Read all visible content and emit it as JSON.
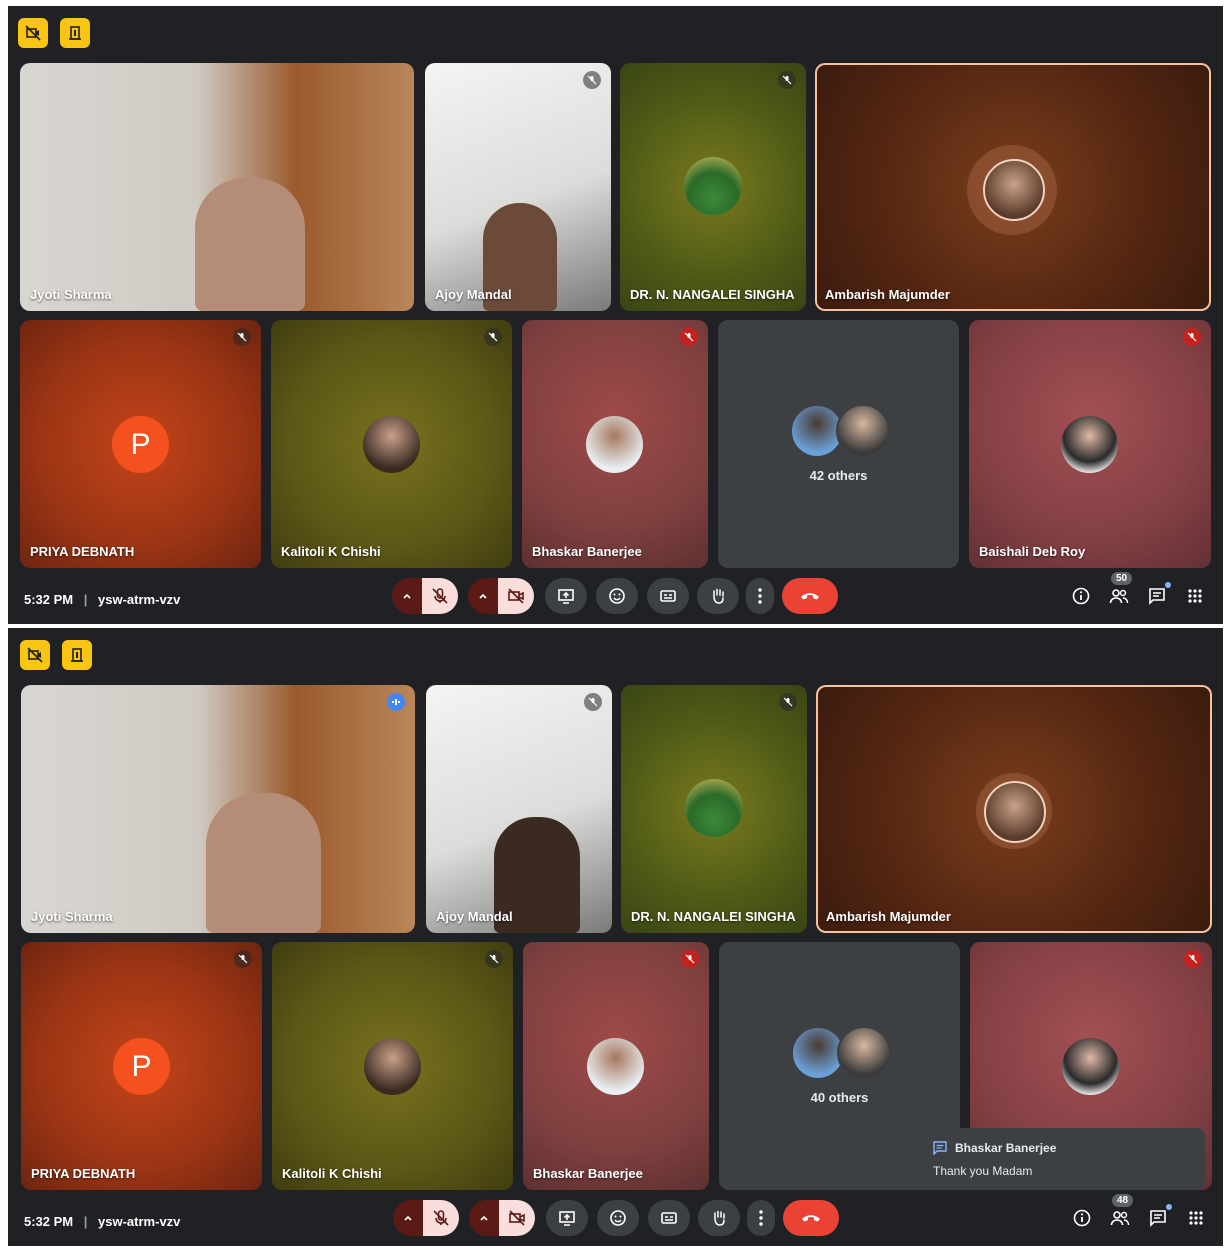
{
  "screens": [
    {
      "tiles": {
        "jyoti": "Jyoti Sharma",
        "ajoy": "Ajoy Mandal",
        "nangalei": "DR. N. NANGALEI SINGHA",
        "ambarish": "Ambarish Majumder",
        "priya": "PRIYA DEBNATH",
        "priya_initial": "P",
        "kalitoli": "Kalitoli K Chishi",
        "bhaskar": "Bhaskar Banerjee",
        "others": "42 others",
        "baishali": "Baishali Deb Roy"
      },
      "bar": {
        "time": "5:32 PM",
        "code": "ysw-atrm-vzv",
        "participants": "50"
      }
    },
    {
      "tiles": {
        "jyoti": "Jyoti Sharma",
        "ajoy": "Ajoy Mandal",
        "nangalei": "DR. N. NANGALEI SINGHA",
        "ambarish": "Ambarish Majumder",
        "priya": "PRIYA DEBNATH",
        "priya_initial": "P",
        "kalitoli": "Kalitoli K Chishi",
        "bhaskar": "Bhaskar Banerjee",
        "others": "40 others"
      },
      "bar": {
        "time": "5:32 PM",
        "code": "ysw-atrm-vzv",
        "participants": "48"
      },
      "toast": {
        "sender": "Bhaskar Banerjee",
        "message": "Thank you Madam"
      }
    }
  ],
  "colors": {
    "accent_yellow": "#f9c513",
    "hangup_red": "#ea4335",
    "meeting_bg": "#202124",
    "mic_off_bg": "#f9dedc"
  }
}
